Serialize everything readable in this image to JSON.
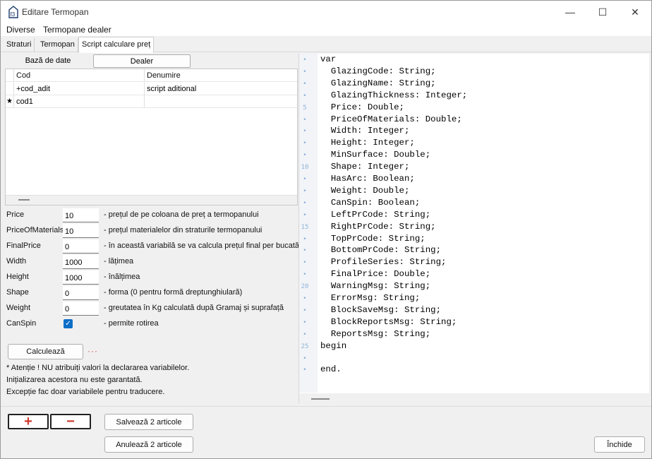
{
  "window": {
    "title": "Editare Termopan",
    "icon_glyph": "f3",
    "minimize_glyph": "—",
    "maximize_glyph": "☐",
    "close_glyph": "✕"
  },
  "menu": [
    "Diverse",
    "Termopane dealer"
  ],
  "tabs": [
    "Straturi",
    "Termopan",
    "Script calculare preț"
  ],
  "subtabs": [
    "Bază de date",
    "Dealer"
  ],
  "grid": {
    "headers": [
      "Cod",
      "Denumire"
    ],
    "rows": [
      {
        "indicator": "",
        "cod": "+cod_adit",
        "denumire": "script aditional"
      },
      {
        "indicator": "★",
        "cod": "cod1",
        "denumire": ""
      }
    ]
  },
  "fields": [
    {
      "label": "Price",
      "value": "10",
      "desc": "- prețul de pe coloana de preț a termopanului"
    },
    {
      "label": "PriceOfMaterials",
      "value": "10",
      "desc": "- prețul materialelor din straturile termopanului"
    },
    {
      "label": "FinalPrice",
      "value": "0",
      "desc": "- în această variabilă se va calcula prețul final per bucată"
    },
    {
      "label": "Width",
      "value": "1000",
      "desc": "- lățimea"
    },
    {
      "label": "Height",
      "value": "1000",
      "desc": "- înălțimea"
    },
    {
      "label": "Shape",
      "value": "0",
      "desc": "- forma (0 pentru formă dreptunghiulară)"
    },
    {
      "label": "Weight",
      "value": "0",
      "desc": "- greutatea în Kg calculată după Gramaj și suprafață"
    }
  ],
  "canspin": {
    "label": "CanSpin",
    "checked": true,
    "check_glyph": "✓",
    "desc": "- permite rotirea"
  },
  "calc_button": "Calculează",
  "calc_dots": "···",
  "notes": [
    "* Atenție ! NU atribuiți valori la declararea variabilelor.",
    "Inițializarea acestora nu este garantată.",
    "Excepție fac doar variabilele pentru traducere."
  ],
  "editor": {
    "lines": [
      "var",
      "  GlazingCode: String;",
      "  GlazingName: String;",
      "  GlazingThickness: Integer;",
      "  Price: Double;",
      "  PriceOfMaterials: Double;",
      "  Width: Integer;",
      "  Height: Integer;",
      "  MinSurface: Double;",
      "  Shape: Integer;",
      "  HasArc: Boolean;",
      "  Weight: Double;",
      "  CanSpin: Boolean;",
      "  LeftPrCode: String;",
      "  RightPrCode: String;",
      "  TopPrCode: String;",
      "  BottomPrCode: String;",
      "  ProfileSeries: String;",
      "  FinalPrice: Double;",
      "  WarningMsg: String;",
      "  ErrorMsg: String;",
      "  BlockSaveMsg: String;",
      "  BlockReportsMsg: String;",
      "  ReportsMsg: String;",
      "begin",
      "",
      "end."
    ],
    "gutter_marks": [
      "•",
      "•",
      "•",
      "•",
      "5",
      "•",
      "•",
      "•",
      "•",
      "10",
      "•",
      "•",
      "•",
      "•",
      "15",
      "•",
      "•",
      "•",
      "•",
      "20",
      "•",
      "•",
      "•",
      "•",
      "25",
      "•",
      "•"
    ]
  },
  "bottom": {
    "add_glyph": "+",
    "remove_glyph": "−",
    "add_color": "#d03a2f",
    "remove_color": "#d03a2f",
    "save_button": "Salvează 2 articole",
    "cancel_button": "Anulează 2 articole",
    "close_button": "Închide"
  },
  "colors": {
    "accent": "#0e6fc7",
    "gutter_numbers": "#8fb4d9"
  }
}
